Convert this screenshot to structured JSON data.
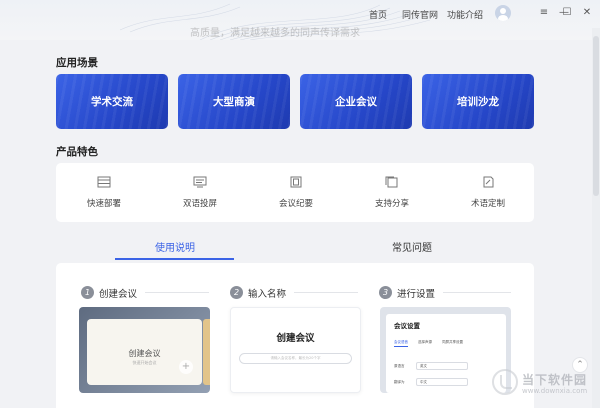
{
  "topbar": {
    "nav": [
      "首页",
      "同传官网",
      "功能介绍"
    ],
    "window_controls": {
      "menu": "≡",
      "minimize": "—",
      "maximize": "☐",
      "close": "✕"
    }
  },
  "banner": {
    "subtitle": "高质量，满足越来越多的同声传译需求"
  },
  "scenes": {
    "title": "应用场景",
    "items": [
      "学术交流",
      "大型商演",
      "企业会议",
      "培训沙龙"
    ]
  },
  "features": {
    "title": "产品特色",
    "items": [
      {
        "label": "快速部署",
        "icon": "server-icon"
      },
      {
        "label": "双语投屏",
        "icon": "screen-icon"
      },
      {
        "label": "会议纪要",
        "icon": "notes-icon"
      },
      {
        "label": "支持分享",
        "icon": "share-icon"
      },
      {
        "label": "术语定制",
        "icon": "edit-icon"
      }
    ]
  },
  "tabs": [
    {
      "label": "使用说明",
      "active": true
    },
    {
      "label": "常见问题",
      "active": false
    }
  ],
  "steps": [
    {
      "num": "1",
      "label": "创建会议"
    },
    {
      "num": "2",
      "label": "输入名称"
    },
    {
      "num": "3",
      "label": "进行设置"
    }
  ],
  "shots": {
    "s1": {
      "title": "创建会议",
      "sub": "快速开始会议",
      "plus": "+"
    },
    "s2": {
      "title": "创建会议",
      "placeholder": "请输入会议名称，最长为20个字"
    },
    "s3": {
      "title": "会议设置",
      "tabs": [
        "会议语音",
        "选择声源",
        "同屏共享设置"
      ],
      "rows": [
        {
          "label": "原语言",
          "value": "英文"
        },
        {
          "label": "翻译为",
          "value": "中文"
        }
      ]
    }
  },
  "watermark": {
    "text": "当下软件园",
    "url": "www.downxia.com",
    "up": "⌃"
  },
  "colors": {
    "accent": "#3b63e6",
    "panel": "#ffffff",
    "bg": "#f1f2f5"
  }
}
